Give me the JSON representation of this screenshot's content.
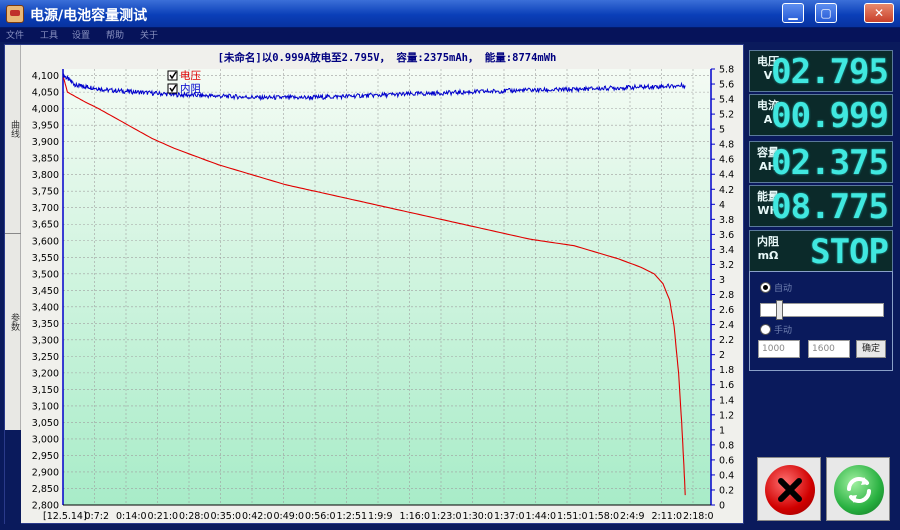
{
  "window": {
    "title": "电源/电池容量测试"
  },
  "menu": [
    "文件",
    "工具",
    "设置",
    "帮助",
    "关于"
  ],
  "side_tabs": [
    "曲线",
    "参数"
  ],
  "chart_data": {
    "type": "line",
    "title": "[未命名]以0.999A放电至2.795V， 容量:2375mAh， 能量:8774mWh",
    "legend": [
      {
        "name": "电压",
        "color": "#e00000",
        "checked": true
      },
      {
        "name": "内阻",
        "color": "#0000cc",
        "checked": true
      }
    ],
    "y_left": {
      "min": 2.8,
      "max": 4.12,
      "ticks": [
        "4,100",
        "4,050",
        "4,000",
        "3,950",
        "3,900",
        "3,850",
        "3,800",
        "3,750",
        "3,700",
        "3,650",
        "3,600",
        "3,550",
        "3,500",
        "3,450",
        "3,400",
        "3,350",
        "3,300",
        "3,250",
        "3,200",
        "3,150",
        "3,100",
        "3,050",
        "3,000",
        "2,950",
        "2,900",
        "2,850",
        "2,800"
      ]
    },
    "y_right": {
      "min": 0,
      "max": 5.8,
      "ticks": [
        "5.8",
        "5.6",
        "5.4",
        "5.2",
        "5",
        "4.8",
        "4.6",
        "4.4",
        "4.2",
        "4",
        "3.8",
        "3.6",
        "3.4",
        "3.2",
        "3",
        "2.8",
        "2.6",
        "2.4",
        "2.2",
        "2",
        "1.8",
        "1.6",
        "1.4",
        "1.2",
        "1",
        "0.8",
        "0.6",
        "0.4",
        "0.2",
        "0"
      ]
    },
    "x_ticks": [
      "[12.5.14]",
      "0:7:2",
      "0:14:0",
      "0:21:0",
      "0:28:0",
      "0:35:0",
      "0:42:0",
      "0:49:0",
      "0:56:0",
      "1:2:51",
      "1:9:9",
      "1:16:0",
      "1:23:0",
      "1:30:0",
      "1:37:0",
      "1:44:0",
      "1:51:0",
      "1:58:0",
      "2:4:9",
      "2:11:0",
      "2:18:0"
    ],
    "x_max_min": 144,
    "series": [
      {
        "name": "电压",
        "color": "#e00000",
        "axis": "left",
        "points": [
          [
            0,
            4.1
          ],
          [
            1,
            4.05
          ],
          [
            3,
            4.035
          ],
          [
            5,
            4.02
          ],
          [
            8,
            4.0
          ],
          [
            12,
            3.97
          ],
          [
            16,
            3.94
          ],
          [
            20,
            3.91
          ],
          [
            25,
            3.88
          ],
          [
            30,
            3.855
          ],
          [
            35,
            3.83
          ],
          [
            40,
            3.81
          ],
          [
            45,
            3.79
          ],
          [
            50,
            3.77
          ],
          [
            55,
            3.755
          ],
          [
            60,
            3.74
          ],
          [
            65,
            3.725
          ],
          [
            70,
            3.71
          ],
          [
            75,
            3.695
          ],
          [
            80,
            3.68
          ],
          [
            85,
            3.665
          ],
          [
            90,
            3.65
          ],
          [
            95,
            3.635
          ],
          [
            100,
            3.62
          ],
          [
            105,
            3.605
          ],
          [
            110,
            3.595
          ],
          [
            115,
            3.585
          ],
          [
            120,
            3.565
          ],
          [
            125,
            3.545
          ],
          [
            130,
            3.52
          ],
          [
            133,
            3.5
          ],
          [
            135,
            3.47
          ],
          [
            136.5,
            3.42
          ],
          [
            137.5,
            3.34
          ],
          [
            138.5,
            3.2
          ],
          [
            139.2,
            3.05
          ],
          [
            139.7,
            2.92
          ],
          [
            140,
            2.83
          ]
        ]
      },
      {
        "name": "内阻",
        "color": "#0000cc",
        "axis": "right",
        "points": [
          [
            0,
            5.72
          ],
          [
            3,
            5.58
          ],
          [
            6,
            5.56
          ],
          [
            10,
            5.52
          ],
          [
            15,
            5.5
          ],
          [
            20,
            5.48
          ],
          [
            25,
            5.46
          ],
          [
            30,
            5.45
          ],
          [
            35,
            5.44
          ],
          [
            40,
            5.43
          ],
          [
            45,
            5.42
          ],
          [
            50,
            5.42
          ],
          [
            55,
            5.42
          ],
          [
            60,
            5.43
          ],
          [
            65,
            5.44
          ],
          [
            70,
            5.45
          ],
          [
            75,
            5.46
          ],
          [
            80,
            5.47
          ],
          [
            85,
            5.48
          ],
          [
            90,
            5.49
          ],
          [
            95,
            5.5
          ],
          [
            100,
            5.51
          ],
          [
            105,
            5.52
          ],
          [
            110,
            5.52
          ],
          [
            115,
            5.53
          ],
          [
            120,
            5.54
          ],
          [
            125,
            5.55
          ],
          [
            130,
            5.56
          ],
          [
            135,
            5.57
          ],
          [
            140,
            5.58
          ]
        ]
      }
    ]
  },
  "readouts": [
    {
      "label_top": "电压",
      "label_bottom": "V",
      "value": "02.795"
    },
    {
      "label_top": "电流",
      "label_bottom": "A",
      "value": "00.999"
    },
    {
      "label_top": "容量",
      "label_bottom": "AH",
      "value": "02.375"
    },
    {
      "label_top": "能量",
      "label_bottom": "WH",
      "value": "08.775"
    },
    {
      "label_top": "内阻",
      "label_bottom": "mΩ",
      "value": "STOP"
    }
  ],
  "controls": {
    "radio_1_label": "自动",
    "radio_2_label": "手动",
    "field_1": "1000",
    "field_2": "1600",
    "ok_label": "确定"
  },
  "colors": {
    "plot_top": "#f4fbf4",
    "plot_bottom": "#a8ecc8",
    "lcd_text": "#40e8e0"
  }
}
